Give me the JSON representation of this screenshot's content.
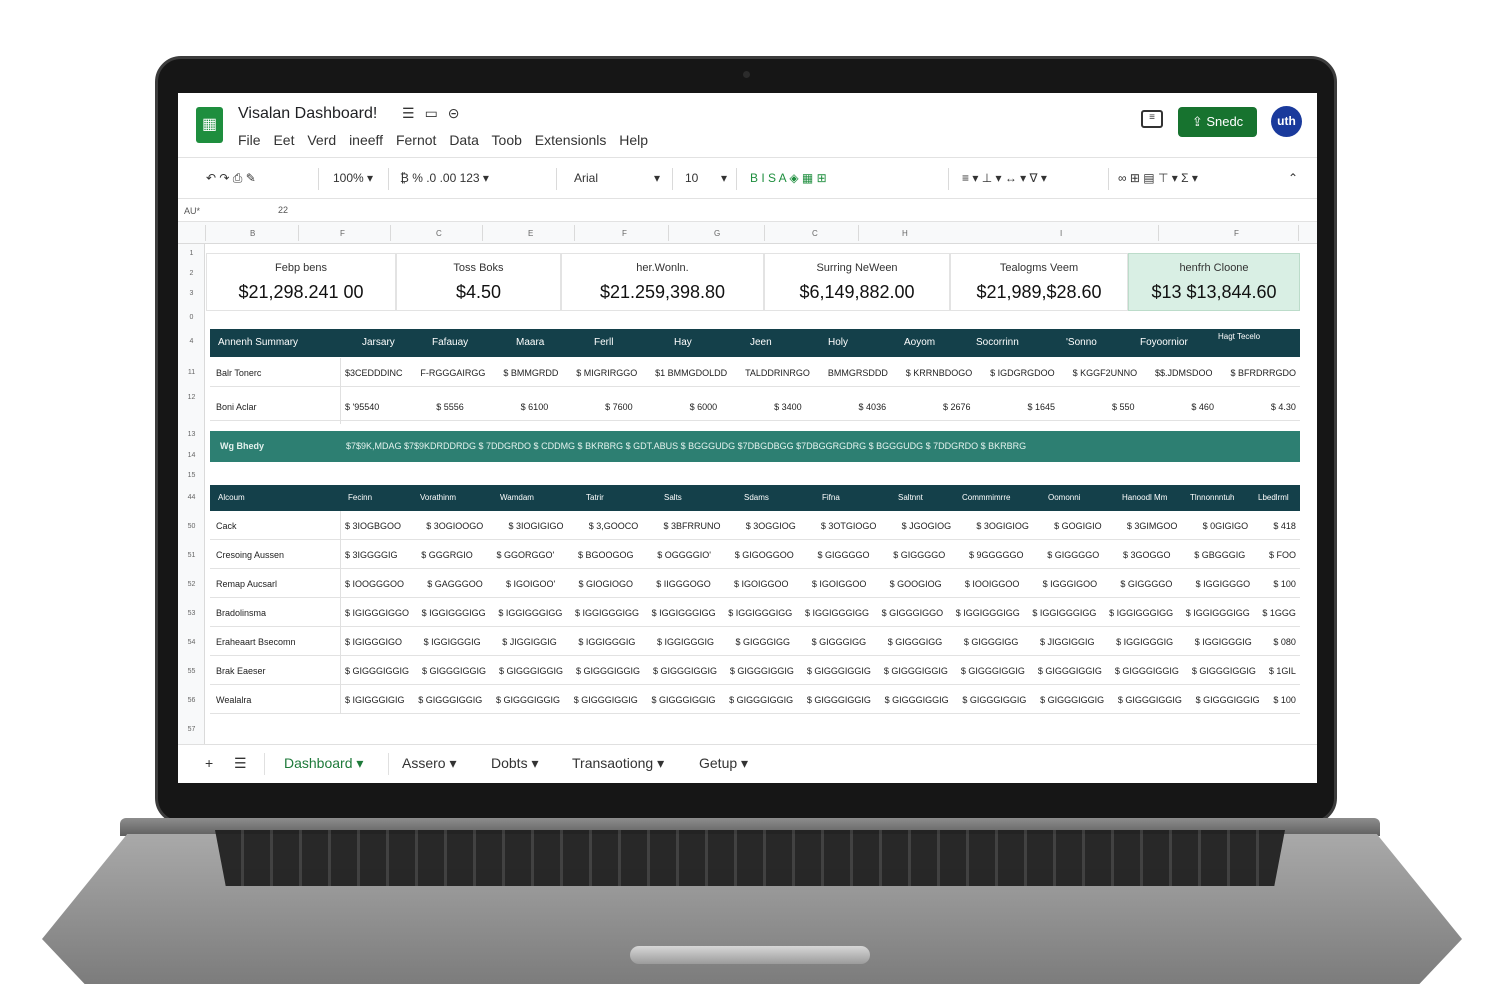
{
  "app": {
    "title": "Visalan Dashboard!",
    "logo_glyph": "▦",
    "title_icons": [
      "☰",
      "▭",
      "⊝"
    ],
    "menu": [
      "File",
      "Eet",
      "Verd",
      "ineeff",
      "Fernot",
      "Data",
      "Toob",
      "Extensionls",
      "Help"
    ],
    "comment_glyph": "≡",
    "share_label": "⇪ Snedc",
    "avatar_label": "uth",
    "accent_color": "#17732f"
  },
  "toolbar": {
    "undo_redo": "↶ ↷ ⎙ ✎",
    "zoom": "100% ▾",
    "format_icons": "₿ % .0 .00 123 ▾",
    "font": "Arial",
    "font_size": "10",
    "style_icons": "B  I  S  A  ◈  ▦  ⊞",
    "align_icons": "≡ ▾  ⊥ ▾  ↔ ▾  ∇ ▾",
    "insert_icons": "∞  ⊞  ▤  ⊤ ▾  Σ ▾",
    "collapse": "⌃"
  },
  "formula_bar": {
    "cell_ref": "AU*",
    "value": "22"
  },
  "columns": [
    "B",
    "F",
    "C",
    "E",
    "F",
    "G",
    "C",
    "H",
    "I",
    "F"
  ],
  "rows": [
    "1",
    "2",
    "3",
    "0",
    "4",
    "11",
    "12",
    "13",
    "14",
    "15",
    "44",
    "50",
    "51",
    "52",
    "53",
    "54",
    "55",
    "56",
    "57"
  ],
  "kpis": [
    {
      "label": "Febp bens",
      "value": "$21,298.241 00"
    },
    {
      "label": "Toss Boks",
      "value": "$4.50"
    },
    {
      "label": "her.Wonln.",
      "value": "$21.259,398.80"
    },
    {
      "label": "Surring NeWeen",
      "value": "$6,149,882.00"
    },
    {
      "label": "Tealogms Veem",
      "value": "$21,989,$28.60"
    },
    {
      "label": "henfrh Cloone",
      "value": "$13 $13,844.60"
    }
  ],
  "monthly": {
    "headers": [
      "Annenh Summary",
      "Jarsary",
      "Fafauay",
      "Maara",
      "Ferll",
      "Hay",
      "Jeen",
      "Holy",
      "Aoyom",
      "Socorrinn",
      "'Sonno",
      "Foyoornior",
      "Hagt Tecelo"
    ],
    "rows": [
      {
        "name": "Balr Tonerc",
        "cells": [
          "$3CEDDDINC",
          "F-RGGGAIRGG",
          "$ BMMGRDD",
          "$ MIGRIRGGO",
          "$1 BMMGDOLDD",
          "TALDDRINRGO",
          "BMMGRSDDD",
          "$ KRRNBDOGO",
          "$ IGDGRGDOO",
          "$ KGGF2UNNO",
          "$$.JDMSDOO",
          "$ BFRDRRGDO"
        ]
      },
      {
        "name": "Boni Aclar",
        "cells": [
          "$ '95540",
          "$ 5556",
          "$ 6100",
          "$ 7600",
          "$ 6000",
          "$ 3400",
          "$ 4036",
          "$ 2676",
          "$ 1645",
          "$ 550",
          "$ 460",
          "$ 4.30"
        ]
      }
    ],
    "total": {
      "name": "Wg Bhedy",
      "text": "$7$9K,MDAG $7$9KDRDDRDG $ 7DDGRDO $ CDDMG $ BKRBRG $ GDT.ABUS $ BGGGUDG $7DBGDBGG $7DBGGRGDRG $ BGGGUDG $ 7DDGRDO $ BKRBRG"
    }
  },
  "accounts": {
    "headers": [
      "Alcoum",
      "Fecinn",
      "Vorathinm",
      "Wamdam",
      "Tatrir",
      "Salts",
      "Sdams",
      "Fifna",
      "Saltnnt",
      "Commmimrre",
      "Oomonni",
      "Hanoodl Mm",
      "Tlnnonnntuh",
      "Lbedlrml"
    ],
    "rows": [
      {
        "name": "Cack",
        "cells": [
          "$ 3IOGBGOO",
          "$ 3OGIOOGO",
          "$ 3IOGIGIGO",
          "$ 3,GOOCO",
          "$ 3BFRRUNO",
          "$ 3OGGIOG",
          "$ 3OTGIOGO",
          "$ JGOGIOG",
          "$ 3OGIGIOG",
          "$ GOGIGIO",
          "$ 3GIMGOO",
          "$ 0GIGIGO",
          "$ 418"
        ]
      },
      {
        "name": "Cresoing Aussen",
        "cells": [
          "$ 3IGGGGIG",
          "$ GGGRGIO",
          "$ GGORGGO'",
          "$ BGOOGOG",
          "$ OGGGGIO'",
          "$ GIGOGGOO",
          "$ GIGGGGO",
          "$ GIGGGGO",
          "$ 9GGGGGO",
          "$ GIGGGGO",
          "$ 3GOGGO",
          "$ GBGGGIG",
          "$ FOO"
        ]
      },
      {
        "name": "Remap Aucsarl",
        "cells": [
          "$ IOOGGGOO",
          "$ GAGGGOO",
          "$ IGOIGOO'",
          "$ GIOGIOGO",
          "$ IIGGGOGO",
          "$ IGOIGGOO",
          "$ IGOIGGOO",
          "$ GOOGIOG",
          "$ IOOIGGOO",
          "$ IGGGIGOO",
          "$ GIGGGGO",
          "$ IGGIGGGO",
          "$ 100"
        ]
      },
      {
        "name": "Bradolinsma",
        "cells": [
          "$ IGIGGGIGGO",
          "$ IGGIGGGIGG",
          "$ IGGIGGGIGG",
          "$ IGGIGGGIGG",
          "$ IGGIGGGIGG",
          "$ IGGIGGGIGG",
          "$ IGGIGGGIGG",
          "$ GIGGGIGGO",
          "$ IGGIGGGIGG",
          "$ IGGIGGGIGG",
          "$ IGGIGGGIGG",
          "$ IGGIGGGIGG",
          "$ 1GGG"
        ]
      },
      {
        "name": "Eraheaart Bsecomn",
        "cells": [
          "$ IGIGGGIGO",
          "$ IGGIGGGIG",
          "$ JIGGIGGIG",
          "$ IGGIGGGIG",
          "$ IGGIGGGIG",
          "$ GIGGGIGG",
          "$ GIGGGIGG",
          "$ GIGGGIGG",
          "$ GIGGGIGG",
          "$ JIGGIGGIG",
          "$ IGGIGGGIG",
          "$ IGGIGGGIG",
          "$ 080"
        ]
      },
      {
        "name": "Brak Eaeser",
        "cells": [
          "$ GIGGGIGGIG",
          "$ GIGGGIGGIG",
          "$ GIGGGIGGIG",
          "$ GIGGGIGGIG",
          "$ GIGGGIGGIG",
          "$ GIGGGIGGIG",
          "$ GIGGGIGGIG",
          "$ GIGGGIGGIG",
          "$ GIGGGIGGIG",
          "$ GIGGGIGGIG",
          "$ GIGGGIGGIG",
          "$ GIGGGIGGIG",
          "$ 1GIL"
        ]
      },
      {
        "name": "Wealalra",
        "cells": [
          "$ IGIGGGIGIG",
          "$ GIGGGIGGIG",
          "$ GIGGGIGGIG",
          "$ GIGGGIGGIG",
          "$ GIGGGIGGIG",
          "$ GIGGGIGGIG",
          "$ GIGGGIGGIG",
          "$ GIGGGIGGIG",
          "$ GIGGGIGGIG",
          "$ GIGGGIGGIG",
          "$ GIGGGIGGIG",
          "$ GIGGGIGGIG",
          "$ 100"
        ]
      }
    ]
  },
  "sheets": {
    "add": "+",
    "list": "☰",
    "tabs": [
      "Dashboard ▾",
      "Assero ▾",
      "Dobts ▾",
      "Transaotiong ▾",
      "Getup ▾"
    ]
  }
}
